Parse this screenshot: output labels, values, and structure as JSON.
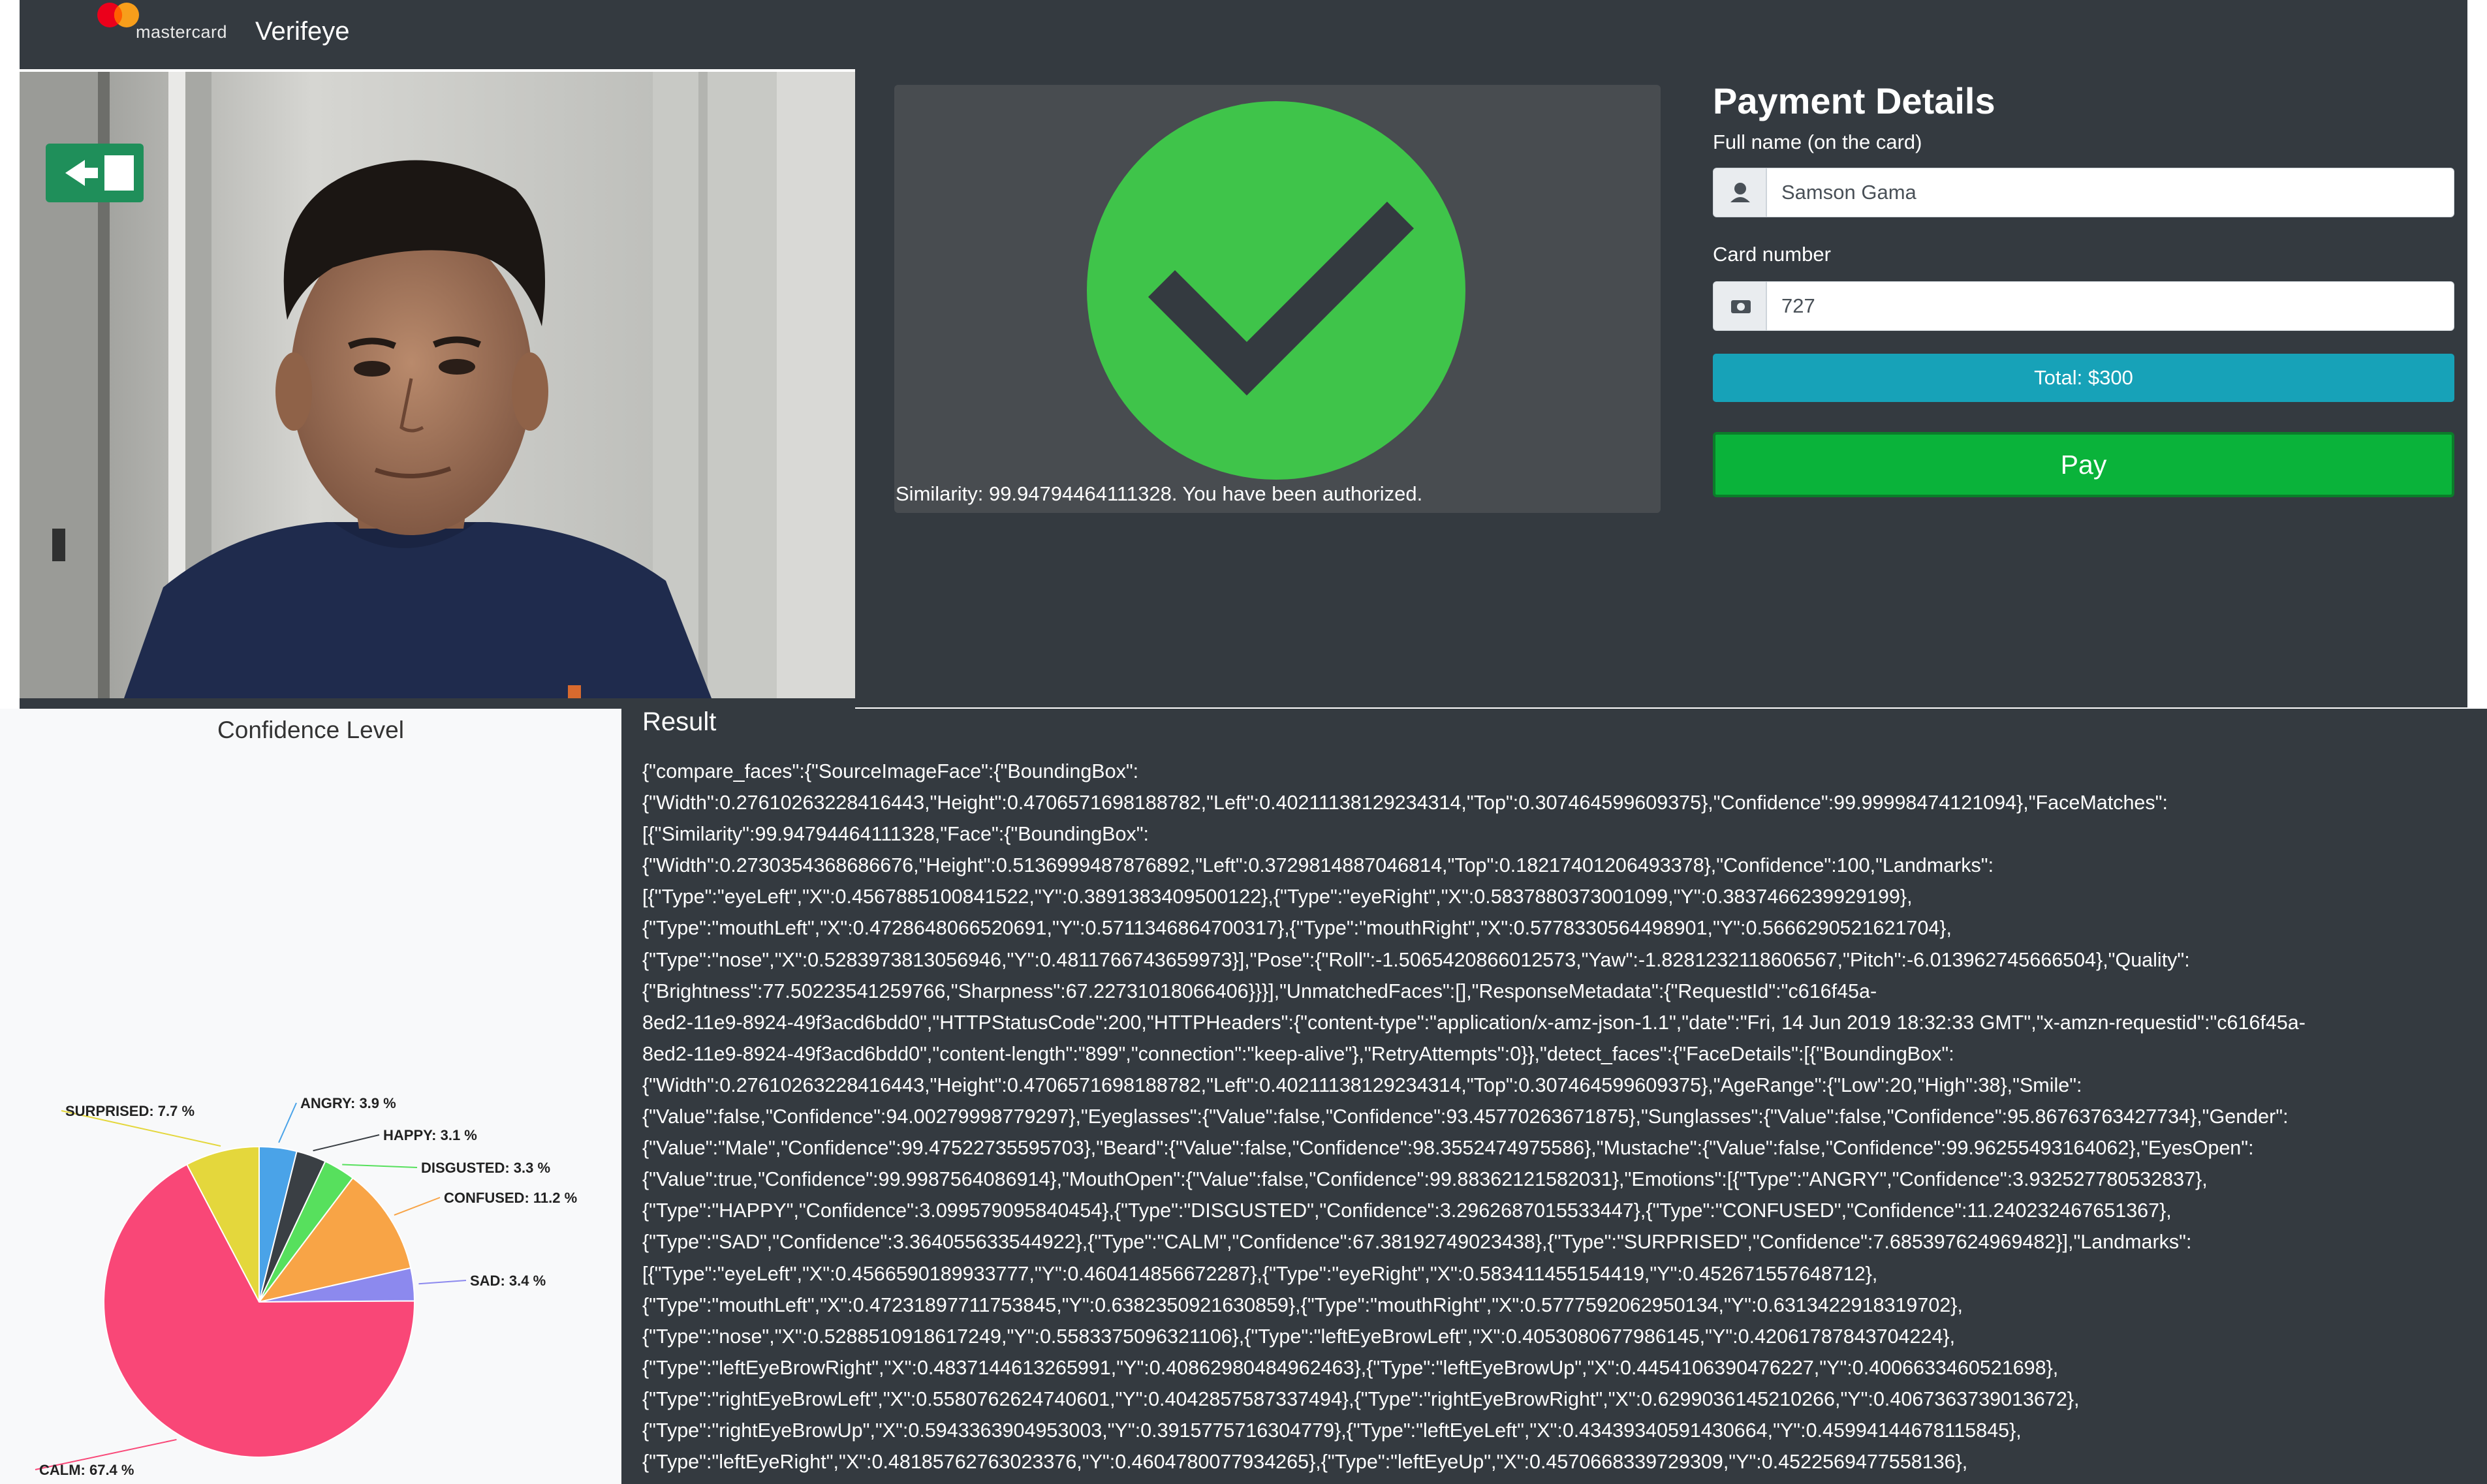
{
  "navbar": {
    "logo_text": "mastercard",
    "brand": "Verifeye"
  },
  "camera": {
    "description_icon": "exit-sign-icon"
  },
  "verification": {
    "status_icon": "check-circle-icon",
    "message": "Similarity: 99.94794464111328. You have been authorized."
  },
  "payment": {
    "title": "Payment Details",
    "name_label": "Full name (on the card)",
    "name_value": "Samson Gama",
    "card_label": "Card number",
    "card_value": "727",
    "total_label": "Total: $300",
    "pay_label": "Pay"
  },
  "chart_data": {
    "type": "pie",
    "title": "Confidence Level",
    "slices": [
      {
        "label": "ANGRY: 3.9 %",
        "name": "ANGRY",
        "value": 3.9,
        "color": "#4aa3e8"
      },
      {
        "label": "HAPPY: 3.1 %",
        "name": "HAPPY",
        "value": 3.1,
        "color": "#3a3f44"
      },
      {
        "label": "DISGUSTED: 3.3 %",
        "name": "DISGUSTED",
        "value": 3.3,
        "color": "#57e05d"
      },
      {
        "label": "CONFUSED: 11.2 %",
        "name": "CONFUSED",
        "value": 11.2,
        "color": "#f8a446"
      },
      {
        "label": "SAD: 3.4 %",
        "name": "SAD",
        "value": 3.4,
        "color": "#8c89ee"
      },
      {
        "label": "CALM: 67.4 %",
        "name": "CALM",
        "value": 67.4,
        "color": "#f94777"
      },
      {
        "label": "SURPRISED: 7.7 %",
        "name": "SURPRISED",
        "value": 7.7,
        "color": "#e4d73c"
      }
    ]
  },
  "result": {
    "title": "Result",
    "lines": [
      "{\"compare_faces\":{\"SourceImageFace\":{\"BoundingBox\":",
      "{\"Width\":0.27610263228416443,\"Height\":0.4706571698188782,\"Left\":0.40211138129234314,\"Top\":0.307464599609375},\"Confidence\":99.99998474121094},\"FaceMatches\":",
      "[{\"Similarity\":99.94794464111328,\"Face\":{\"BoundingBox\":",
      "{\"Width\":0.2730354368686676,\"Height\":0.5136999487876892,\"Left\":0.3729814887046814,\"Top\":0.18217401206493378},\"Confidence\":100,\"Landmarks\":",
      "[{\"Type\":\"eyeLeft\",\"X\":0.4567885100841522,\"Y\":0.3891383409500122},{\"Type\":\"eyeRight\",\"X\":0.5837880373001099,\"Y\":0.3837466239929199},",
      "{\"Type\":\"mouthLeft\",\"X\":0.4728648066520691,\"Y\":0.5711346864700317},{\"Type\":\"mouthRight\",\"X\":0.5778330564498901,\"Y\":0.5666290521621704},",
      "{\"Type\":\"nose\",\"X\":0.5283973813056946,\"Y\":0.4811766743659973}],\"Pose\":{\"Roll\":-1.5065420866012573,\"Yaw\":-1.8281232118606567,\"Pitch\":-6.013962745666504},\"Quality\":",
      "{\"Brightness\":77.50223541259766,\"Sharpness\":67.22731018066406}}}],\"UnmatchedFaces\":[],\"ResponseMetadata\":{\"RequestId\":\"c616f45a-",
      "8ed2-11e9-8924-49f3acd6bdd0\",\"HTTPStatusCode\":200,\"HTTPHeaders\":{\"content-type\":\"application/x-amz-json-1.1\",\"date\":\"Fri, 14 Jun 2019 18:32:33 GMT\",\"x-amzn-requestid\":\"c616f45a-",
      "8ed2-11e9-8924-49f3acd6bdd0\",\"content-length\":\"899\",\"connection\":\"keep-alive\"},\"RetryAttempts\":0}},\"detect_faces\":{\"FaceDetails\":[{\"BoundingBox\":",
      "{\"Width\":0.27610263228416443,\"Height\":0.4706571698188782,\"Left\":0.40211138129234314,\"Top\":0.307464599609375},\"AgeRange\":{\"Low\":20,\"High\":38},\"Smile\":",
      "{\"Value\":false,\"Confidence\":94.00279998779297},\"Eyeglasses\":{\"Value\":false,\"Confidence\":93.45770263671875},\"Sunglasses\":{\"Value\":false,\"Confidence\":95.86763763427734},\"Gender\":",
      "{\"Value\":\"Male\",\"Confidence\":99.47522735595703},\"Beard\":{\"Value\":false,\"Confidence\":98.3552474975586},\"Mustache\":{\"Value\":false,\"Confidence\":99.96255493164062},\"EyesOpen\":",
      "{\"Value\":true,\"Confidence\":99.9987564086914},\"MouthOpen\":{\"Value\":false,\"Confidence\":99.88362121582031},\"Emotions\":[{\"Type\":\"ANGRY\",\"Confidence\":3.932527780532837},",
      "{\"Type\":\"HAPPY\",\"Confidence\":3.099579095840454},{\"Type\":\"DISGUSTED\",\"Confidence\":3.2962687015533447},{\"Type\":\"CONFUSED\",\"Confidence\":11.240232467651367},",
      "{\"Type\":\"SAD\",\"Confidence\":3.364055633544922},{\"Type\":\"CALM\",\"Confidence\":67.38192749023438},{\"Type\":\"SURPRISED\",\"Confidence\":7.685397624969482}],\"Landmarks\":",
      "[{\"Type\":\"eyeLeft\",\"X\":0.4566590189933777,\"Y\":0.460414856672287},{\"Type\":\"eyeRight\",\"X\":0.583411455154419,\"Y\":0.452671557648712},",
      "{\"Type\":\"mouthLeft\",\"X\":0.47231897711753845,\"Y\":0.6382350921630859},{\"Type\":\"mouthRight\",\"X\":0.5777592062950134,\"Y\":0.6313422918319702},",
      "{\"Type\":\"nose\",\"X\":0.5288510918617249,\"Y\":0.5583375096321106},{\"Type\":\"leftEyeBrowLeft\",\"X\":0.4053080677986145,\"Y\":0.42061787843704224},",
      "{\"Type\":\"leftEyeBrowRight\",\"X\":0.4837144613265991,\"Y\":0.40862980484962463},{\"Type\":\"leftEyeBrowUp\",\"X\":0.4454106390476227,\"Y\":0.4006633460521698},",
      "{\"Type\":\"rightEyeBrowLeft\",\"X\":0.5580762624740601,\"Y\":0.4042857587337494},{\"Type\":\"rightEyeBrowRight\",\"X\":0.6299036145210266,\"Y\":0.4067363739013672},",
      "{\"Type\":\"rightEyeBrowUp\",\"X\":0.5943363904953003,\"Y\":0.3915775716304779},{\"Type\":\"leftEyeLeft\",\"X\":0.43439340591430664,\"Y\":0.45994144678115845},",
      "{\"Type\":\"leftEyeRight\",\"X\":0.48185762763023376,\"Y\":0.4604780077934265},{\"Type\":\"leftEyeUp\",\"X\":0.4570668339729309,\"Y\":0.4522569477558136},"
    ]
  }
}
